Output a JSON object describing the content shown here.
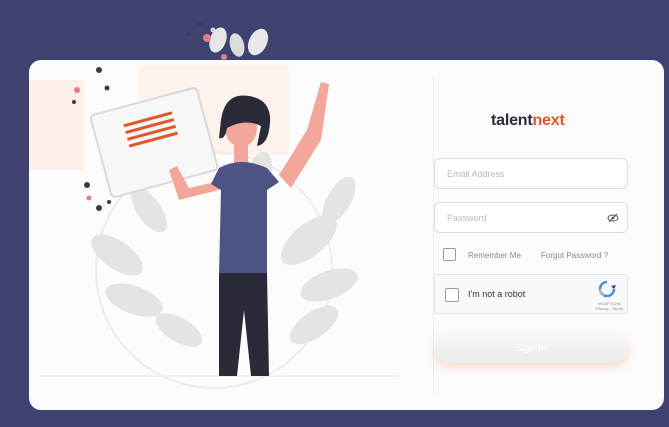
{
  "brand": {
    "part1": "talent",
    "part2": "next",
    "accent_color": "#e0572a",
    "text_color": "#2b2b3b"
  },
  "background_color": "#3e4270",
  "form": {
    "email_placeholder": "Email Address",
    "password_placeholder": "Password",
    "password_toggle_icon": "eye-icon",
    "remember_label": "Remember Me",
    "forgot_label": "Forgot Password ?",
    "captcha_label": "I'm not a robot",
    "captcha_brand_line1": "reCAPTCHA",
    "captcha_brand_line2": "Privacy - Terms",
    "signin_label": "Sign In"
  },
  "illustration": {
    "icons": [
      "woman-holding-document-illustration",
      "leaf-plant-decor",
      "confetti-dots"
    ],
    "colors": {
      "shirt": "#4e5386",
      "skin": "#f3a79a",
      "hair": "#2a2a38",
      "pants": "#2a2a38",
      "leaf": "#e2e2e2"
    }
  }
}
